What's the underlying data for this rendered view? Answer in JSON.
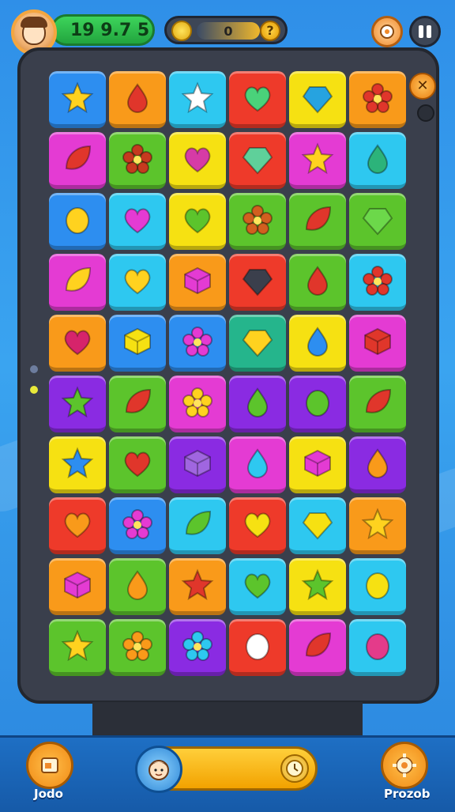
{
  "hud": {
    "score": "19 9.7 5",
    "coins": "0",
    "help": "?",
    "side_button": "✕"
  },
  "bottom": {
    "left_label": "Jodo",
    "right_label": "Prozob"
  },
  "colors": {
    "blue": "#2d8ef0",
    "orange": "#f99a1a",
    "cyan": "#2ec8f0",
    "red": "#ee3a2a",
    "yellow": "#f6e112",
    "magenta": "#e43bd3",
    "green": "#5cc42c",
    "purple": "#8a2be2",
    "teal": "#25b58c"
  },
  "board": [
    [
      {
        "c": "blue",
        "i": "star",
        "ic": "#ffd21f"
      },
      {
        "c": "orange",
        "i": "drop",
        "ic": "#e0362b"
      },
      {
        "c": "cyan",
        "i": "star",
        "ic": "#ffffff"
      },
      {
        "c": "red",
        "i": "heart",
        "ic": "#4ad27a"
      },
      {
        "c": "yellow",
        "i": "gem",
        "ic": "#26a3e0"
      },
      {
        "c": "orange",
        "i": "flower",
        "ic": "#e0362b"
      }
    ],
    [
      {
        "c": "magenta",
        "i": "leaf",
        "ic": "#e0362b"
      },
      {
        "c": "green",
        "i": "flower",
        "ic": "#c63a1f"
      },
      {
        "c": "yellow",
        "i": "heart",
        "ic": "#d63ba6"
      },
      {
        "c": "red",
        "i": "gem",
        "ic": "#5fd09a"
      },
      {
        "c": "magenta",
        "i": "star",
        "ic": "#ffd21f"
      },
      {
        "c": "cyan",
        "i": "drop",
        "ic": "#2cb37a"
      }
    ],
    [
      {
        "c": "blue",
        "i": "egg",
        "ic": "#ffd21f"
      },
      {
        "c": "cyan",
        "i": "heart",
        "ic": "#e43bd3"
      },
      {
        "c": "yellow",
        "i": "heart",
        "ic": "#5cc42c"
      },
      {
        "c": "green",
        "i": "flower",
        "ic": "#d25f1f"
      },
      {
        "c": "green",
        "i": "leaf",
        "ic": "#e0362b"
      },
      {
        "c": "green",
        "i": "gem",
        "ic": "#6cd84a"
      }
    ],
    [
      {
        "c": "magenta",
        "i": "leaf",
        "ic": "#ffd21f"
      },
      {
        "c": "cyan",
        "i": "heart",
        "ic": "#ffd21f"
      },
      {
        "c": "orange",
        "i": "cube",
        "ic": "#e43bd3"
      },
      {
        "c": "red",
        "i": "gem",
        "ic": "#3b3f4c"
      },
      {
        "c": "green",
        "i": "drop",
        "ic": "#e0362b"
      },
      {
        "c": "cyan",
        "i": "flower",
        "ic": "#e0362b"
      }
    ],
    [
      {
        "c": "orange",
        "i": "heart",
        "ic": "#d6246b"
      },
      {
        "c": "blue",
        "i": "cube",
        "ic": "#f6e112"
      },
      {
        "c": "blue",
        "i": "flower",
        "ic": "#e43bd3"
      },
      {
        "c": "teal",
        "i": "gem",
        "ic": "#ffd21f"
      },
      {
        "c": "yellow",
        "i": "drop",
        "ic": "#2d8ef0"
      },
      {
        "c": "magenta",
        "i": "cube",
        "ic": "#e0362b"
      }
    ],
    [
      {
        "c": "purple",
        "i": "star",
        "ic": "#5cc42c"
      },
      {
        "c": "green",
        "i": "leaf",
        "ic": "#e0362b"
      },
      {
        "c": "magenta",
        "i": "flower",
        "ic": "#ffd21f"
      },
      {
        "c": "purple",
        "i": "drop",
        "ic": "#5cc42c"
      },
      {
        "c": "purple",
        "i": "egg",
        "ic": "#5cc42c"
      },
      {
        "c": "green",
        "i": "leaf",
        "ic": "#e0362b"
      }
    ],
    [
      {
        "c": "yellow",
        "i": "star",
        "ic": "#2d8ef0"
      },
      {
        "c": "green",
        "i": "heart",
        "ic": "#e0362b"
      },
      {
        "c": "purple",
        "i": "cube",
        "ic": "#a066e0"
      },
      {
        "c": "magenta",
        "i": "drop",
        "ic": "#2ec8f0"
      },
      {
        "c": "yellow",
        "i": "cube",
        "ic": "#e43bd3"
      },
      {
        "c": "purple",
        "i": "drop",
        "ic": "#f99a1a"
      }
    ],
    [
      {
        "c": "red",
        "i": "heart",
        "ic": "#f99a1a"
      },
      {
        "c": "blue",
        "i": "flower",
        "ic": "#e43bd3"
      },
      {
        "c": "cyan",
        "i": "leaf",
        "ic": "#5cc42c"
      },
      {
        "c": "red",
        "i": "heart",
        "ic": "#f6e112"
      },
      {
        "c": "cyan",
        "i": "gem",
        "ic": "#f6e112"
      },
      {
        "c": "orange",
        "i": "star",
        "ic": "#ffd21f"
      }
    ],
    [
      {
        "c": "orange",
        "i": "cube",
        "ic": "#e43bd3"
      },
      {
        "c": "green",
        "i": "drop",
        "ic": "#f99a1a"
      },
      {
        "c": "orange",
        "i": "star",
        "ic": "#e0362b"
      },
      {
        "c": "cyan",
        "i": "heart",
        "ic": "#5cc42c"
      },
      {
        "c": "yellow",
        "i": "star",
        "ic": "#5cc42c"
      },
      {
        "c": "cyan",
        "i": "egg",
        "ic": "#f6e112"
      }
    ],
    [
      {
        "c": "green",
        "i": "star",
        "ic": "#ffd21f"
      },
      {
        "c": "green",
        "i": "flower",
        "ic": "#f99a1a"
      },
      {
        "c": "purple",
        "i": "flower",
        "ic": "#2ec8f0"
      },
      {
        "c": "red",
        "i": "egg",
        "ic": "#ffffff"
      },
      {
        "c": "magenta",
        "i": "leaf",
        "ic": "#e0362b"
      },
      {
        "c": "cyan",
        "i": "egg",
        "ic": "#e43b8a"
      }
    ]
  ]
}
